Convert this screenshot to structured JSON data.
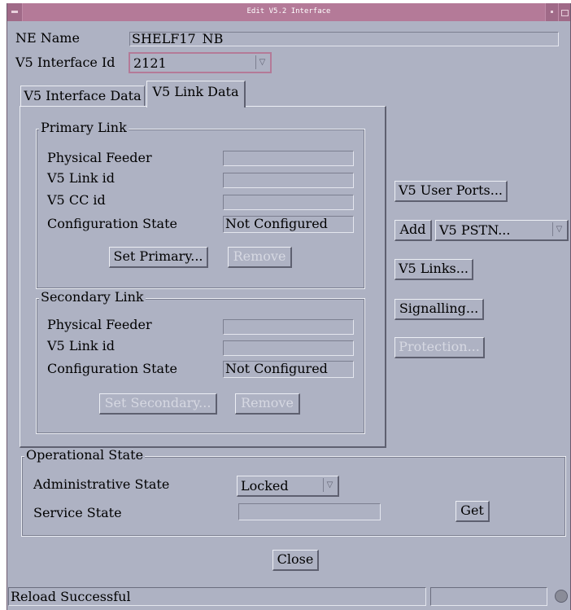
{
  "window": {
    "title": "Edit V5.2 Interface"
  },
  "header": {
    "ne_name_label": "NE Name",
    "ne_name_value": "SHELF17_NB",
    "v5_interface_id_label": "V5 Interface Id",
    "v5_interface_id_value": "2121"
  },
  "tabs": [
    {
      "label": "V5 Interface Data",
      "active": false
    },
    {
      "label": "V5 Link Data",
      "active": true
    }
  ],
  "primary_link": {
    "title": "Primary Link",
    "physical_feeder_label": "Physical Feeder",
    "physical_feeder_value": "",
    "v5_link_id_label": "V5 Link id",
    "v5_link_id_value": "",
    "v5_cc_id_label": "V5 CC id",
    "v5_cc_id_value": "",
    "config_state_label": "Configuration State",
    "config_state_value": "Not Configured",
    "set_primary_button": "Set Primary...",
    "remove_button": "Remove"
  },
  "secondary_link": {
    "title": "Secondary Link",
    "physical_feeder_label": "Physical Feeder",
    "physical_feeder_value": "",
    "v5_link_id_label": "V5 Link id",
    "v5_link_id_value": "",
    "config_state_label": "Configuration State",
    "config_state_value": "Not Configured",
    "set_secondary_button": "Set Secondary...",
    "remove_button": "Remove"
  },
  "side_buttons": {
    "v5_user_ports": "V5 User Ports...",
    "add": "Add",
    "add_type_value": "V5 PSTN...",
    "v5_links": "V5 Links...",
    "signalling": "Signalling...",
    "protection": "Protection..."
  },
  "operational_state": {
    "title": "Operational State",
    "admin_state_label": "Administrative State",
    "admin_state_value": "Locked",
    "service_state_label": "Service State",
    "service_state_value": "",
    "get_button": "Get"
  },
  "footer": {
    "close_button": "Close",
    "status_message": "Reload Successful",
    "status_secondary": ""
  },
  "colors": {
    "window_bg": "#aeb2c3",
    "titlebar_bg": "#b47a98",
    "disabled_text": "#d6d8e2"
  },
  "icons": {
    "window_menu": "window-menu-icon",
    "minimize": "minimize-icon",
    "maximize": "maximize-icon",
    "combo_arrow": "chevron-down-icon",
    "status_led": "status-led-icon"
  }
}
